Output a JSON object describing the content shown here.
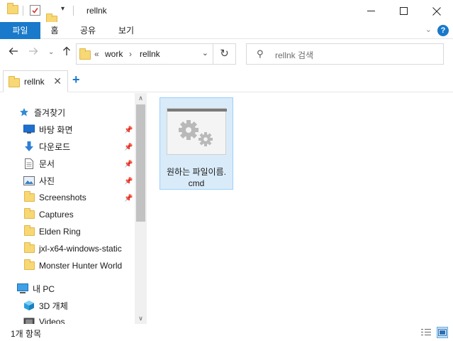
{
  "window": {
    "title": "rellnk",
    "minimize_icon": "minimize-icon",
    "maximize_icon": "maximize-icon",
    "close_icon": "close-icon"
  },
  "ribbon": {
    "tabs": [
      "파일",
      "홈",
      "공유",
      "보기"
    ],
    "active_tab": "파일",
    "accent_color": "#1979ca"
  },
  "address": {
    "overflow": "«",
    "segments": [
      "work",
      "rellnk"
    ],
    "separator": "›"
  },
  "search": {
    "placeholder": "rellnk 검색"
  },
  "folder_tab": {
    "label": "rellnk",
    "add_symbol": "+"
  },
  "sidebar": {
    "quick_access": "즐겨찾기",
    "pinned": [
      {
        "label": "바탕 화면",
        "icon": "desktop-icon"
      },
      {
        "label": "다운로드",
        "icon": "download-icon"
      },
      {
        "label": "문서",
        "icon": "document-icon"
      },
      {
        "label": "사진",
        "icon": "pictures-icon"
      },
      {
        "label": "Screenshots",
        "icon": "folder-icon"
      }
    ],
    "folders": [
      "Captures",
      "Elden Ring",
      "jxl-x64-windows-static",
      "Monster Hunter World"
    ],
    "this_pc": "내 PC",
    "pc_items": [
      {
        "label": "3D 개체",
        "icon": "3d-objects-icon"
      },
      {
        "label": "Videos",
        "icon": "videos-icon"
      }
    ]
  },
  "content": {
    "file": {
      "name_line1": "원하는 파일이름.",
      "name_line2": "cmd",
      "icon": "cmd-settings-file-icon",
      "selected": true
    }
  },
  "status": {
    "count_text": "1개 항목",
    "views": [
      "details-view-icon",
      "large-icons-view-icon"
    ],
    "active_view": "large-icons-view-icon"
  }
}
